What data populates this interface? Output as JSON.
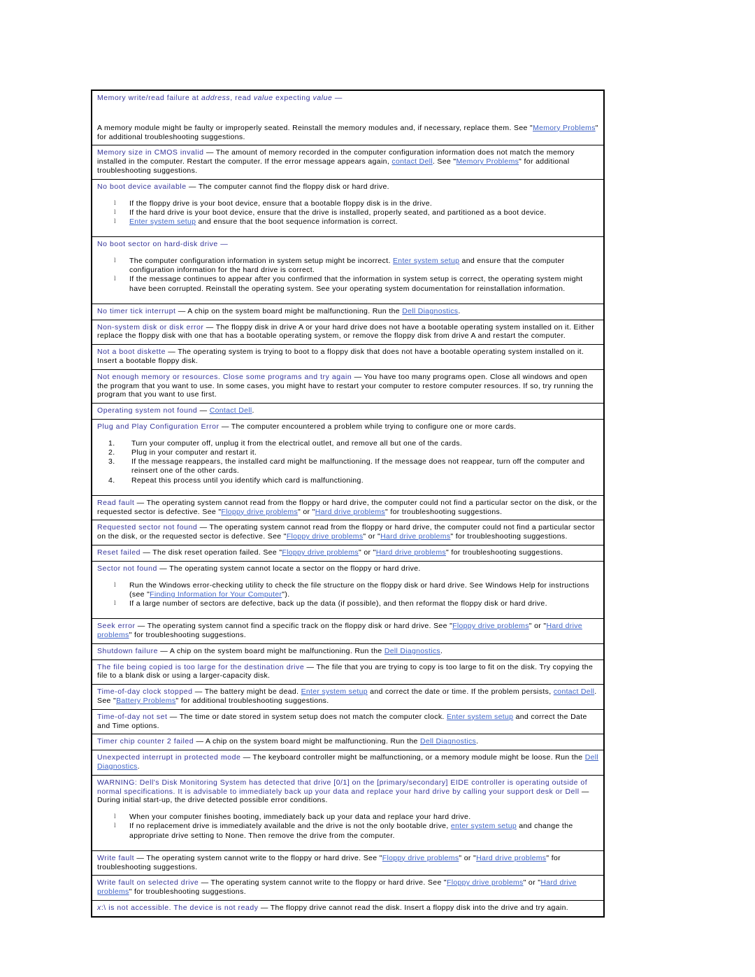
{
  "document": {
    "type": "dell-system-messages-table",
    "colors": {
      "term": "#333399",
      "link": "#3f63c6",
      "border": "#000000",
      "text": "#000000",
      "background": "#ffffff"
    },
    "bullet_glyph": "l"
  },
  "rows": {
    "memory_write_read": {
      "term": "Memory write/read failure at ",
      "term_italic_1": "address",
      "term_mid_1": ", read ",
      "term_italic_2": "value",
      "term_mid_2": " expecting ",
      "term_italic_3": "value",
      "term_dash": " —",
      "body_1": "A memory module might be faulty or improperly seated. Reinstall the memory modules and, if necessary, replace them. See \"",
      "link_1": "Memory Problems",
      "body_2": "\" for additional troubleshooting suggestions."
    },
    "memory_size_cmos": {
      "term": "Memory size in CMOS invalid",
      "dash": " — ",
      "body_1": "The amount of memory recorded in the computer configuration information does not match the memory installed in the computer. Restart the computer. If the error message appears again, ",
      "link_1": "contact Dell",
      "body_2": ". See \"",
      "link_2": "Memory Problems",
      "body_3": "\" for additional troubleshooting suggestions."
    },
    "no_boot_device": {
      "term": "No boot device available",
      "dash": " — ",
      "body": "The computer cannot find the floppy disk or hard drive.",
      "bullets": [
        {
          "text": "If the floppy drive is your boot device, ensure that a bootable floppy disk is in the drive."
        },
        {
          "text": "If the hard drive is your boot device, ensure that the drive is installed, properly seated, and partitioned as a boot device."
        },
        {
          "link": "Enter system setup",
          "text": " and ensure that the boot sequence information is correct."
        }
      ]
    },
    "no_boot_sector": {
      "term": "No boot sector on hard-disk drive",
      "dash": " —",
      "bullets": [
        {
          "pre": "The computer configuration information in system setup might be incorrect. ",
          "link": "Enter system setup",
          "text": " and ensure that the computer configuration information for the hard drive is correct."
        },
        {
          "text": "If the message continues to appear after you confirmed that the information in system setup is correct, the operating system might have been corrupted. Reinstall the operating system. See your operating system documentation for reinstallation information."
        }
      ]
    },
    "no_timer_tick": {
      "term": "No timer tick interrupt",
      "dash": " — ",
      "body_1": "A chip on the system board might be malfunctioning. Run the ",
      "link_1": "Dell Diagnostics",
      "body_2": "."
    },
    "non_system_disk": {
      "term": "Non-system disk or disk error",
      "dash": " — ",
      "body": "The floppy disk in drive A or your hard drive does not have a bootable operating system installed on it. Either replace the floppy disk with one that has a bootable operating system, or remove the floppy disk from drive A and restart the computer."
    },
    "not_boot_diskette": {
      "term": "Not a boot diskette",
      "dash": " — ",
      "body": "The operating system is trying to boot to a floppy disk that does not have a bootable operating system installed on it. Insert a bootable floppy disk."
    },
    "not_enough_memory": {
      "term": "Not enough memory or resources. Close some programs and try again",
      "dash": " — ",
      "body": "You have too many programs open. Close all windows and open the program that you want to use. In some cases, you might have to restart your computer to restore computer resources. If so, try running the program that you want to use first."
    },
    "os_not_found": {
      "term": "Operating system not found",
      "dash": " — ",
      "link_1": "Contact Dell",
      "body_2": "."
    },
    "pnp_config_error": {
      "term": "Plug and Play Configuration Error",
      "dash": " — ",
      "body": "The computer encountered a problem while trying to configure one or more cards.",
      "steps": [
        "Turn your computer off, unplug it from the electrical outlet, and remove all but one of the cards.",
        "Plug in your computer and restart it.",
        "If the message reappears, the installed card might be malfunctioning. If the message does not reappear, turn off the computer and reinsert one of the other cards.",
        "Repeat this process until you identify which card is malfunctioning."
      ]
    },
    "read_fault": {
      "term": "Read fault",
      "dash": " — ",
      "body_1": "The operating system cannot read from the floppy or hard drive, the computer could not find a particular sector on the disk, or the requested sector is defective. See \"",
      "link_1": "Floppy drive problems",
      "body_2": "\" or \"",
      "link_2": "Hard drive problems",
      "body_3": "\" for troubleshooting suggestions."
    },
    "requested_sector": {
      "term": "Requested sector not found",
      "dash": " — ",
      "body_1": "The operating system cannot read from the floppy or hard drive, the computer could not find a particular sector on the disk, or the requested sector is defective. See \"",
      "link_1": "Floppy drive problems",
      "body_2": "\" or \"",
      "link_2": "Hard drive problems",
      "body_3": "\" for troubleshooting suggestions."
    },
    "reset_failed": {
      "term": "Reset failed",
      "dash": " — ",
      "body_1": "The disk reset operation failed. See \"",
      "link_1": "Floppy drive problems",
      "body_2": "\" or \"",
      "link_2": "Hard drive problems",
      "body_3": "\" for troubleshooting suggestions."
    },
    "sector_not_found": {
      "term": "Sector not found",
      "dash": " — ",
      "body": "The operating system cannot locate a sector on the floppy or hard drive.",
      "bullets": [
        {
          "pre": "Run the Windows error-checking utility to check the file structure on the floppy disk or hard drive. See Windows Help for instructions (see \"",
          "link": "Finding Information for Your Computer",
          "text": "\")."
        },
        {
          "text": "If a large number of sectors are defective, back up the data (if possible), and then reformat the floppy disk or hard drive."
        }
      ]
    },
    "seek_error": {
      "term": "Seek error",
      "dash": " — ",
      "body_1": "The operating system cannot find a specific track on the floppy disk or hard drive. See \"",
      "link_1": "Floppy drive problems",
      "body_2": "\" or \"",
      "link_2": "Hard drive problems",
      "body_3": "\" for troubleshooting suggestions."
    },
    "shutdown_failure": {
      "term": "Shutdown failure",
      "dash": " — ",
      "body_1": "A chip on the system board might be malfunctioning. Run the ",
      "link_1": "Dell Diagnostics",
      "body_2": "."
    },
    "file_too_large": {
      "term": "The file being copied is too large for the destination drive",
      "dash": " — ",
      "body": "The file that you are trying to copy is too large to fit on the disk. Try copying the file to a blank disk or using a larger-capacity disk."
    },
    "tod_clock_stopped": {
      "term": "Time-of-day clock stopped",
      "dash": " — ",
      "body_1": "The battery might be dead. ",
      "link_1": "Enter system setup",
      "body_2": " and correct the date or time. If the problem persists, ",
      "link_2": "contact Dell",
      "body_3": ". See \"",
      "link_3": "Battery Problems",
      "body_4": "\" for additional troubleshooting suggestions."
    },
    "tod_not_set": {
      "term": "Time-of-day not set",
      "dash": " — ",
      "body_1": "The time or date stored in system setup does not match the computer clock. ",
      "link_1": "Enter system setup",
      "body_2": " and correct the Date and Time options."
    },
    "timer_chip_counter": {
      "term": "Timer chip counter 2 failed",
      "dash": " — ",
      "body_1": "A chip on the system board might be malfunctioning. Run the ",
      "link_1": "Dell Diagnostics",
      "body_2": "."
    },
    "unexpected_interrupt": {
      "term": "Unexpected interrupt in protected mode",
      "dash": " — ",
      "body_1": "The keyboard controller might be malfunctioning, or a memory module might be loose. Run the ",
      "link_1": "Dell Diagnostics",
      "body_2": "."
    },
    "warning_disk_monitoring": {
      "term": "WARNING: Dell's Disk Monitoring System has detected that drive [0/1] on the [primary/secondary] EIDE controller is operating outside of normal specifications. It is advisable to immediately back up your data and replace your hard drive by calling your support desk or Dell",
      "dash": " — ",
      "body": "During initial start-up, the drive detected possible error conditions.",
      "bullets": [
        {
          "text": "When your computer finishes booting, immediately back up your data and replace your hard drive."
        },
        {
          "pre": "If no replacement drive is immediately available and the drive is not the only bootable drive, ",
          "link": "enter system setup",
          "text": " and change the appropriate drive setting to None. Then remove the drive from the computer."
        }
      ]
    },
    "write_fault": {
      "term": "Write fault",
      "dash": " — ",
      "body_1": "The operating system cannot write to the floppy or hard drive. See \"",
      "link_1": "Floppy drive problems",
      "body_2": "\" or \"",
      "link_2": "Hard drive problems",
      "body_3": "\" for troubleshooting suggestions."
    },
    "write_fault_selected": {
      "term": "Write fault on selected drive",
      "dash": " — ",
      "body_1": "The operating system cannot write to the floppy or hard drive. See \"",
      "link_1": "Floppy drive problems",
      "body_2": "\" or \"",
      "link_2": "Hard drive problems",
      "body_3": "\" for troubleshooting suggestions."
    },
    "x_not_accessible": {
      "term_italic": "x",
      "term_rest": ":\\ is not accessible. The device is not ready",
      "dash": " — ",
      "body": "The floppy drive cannot read the disk. Insert a floppy disk into the drive and try again."
    }
  }
}
